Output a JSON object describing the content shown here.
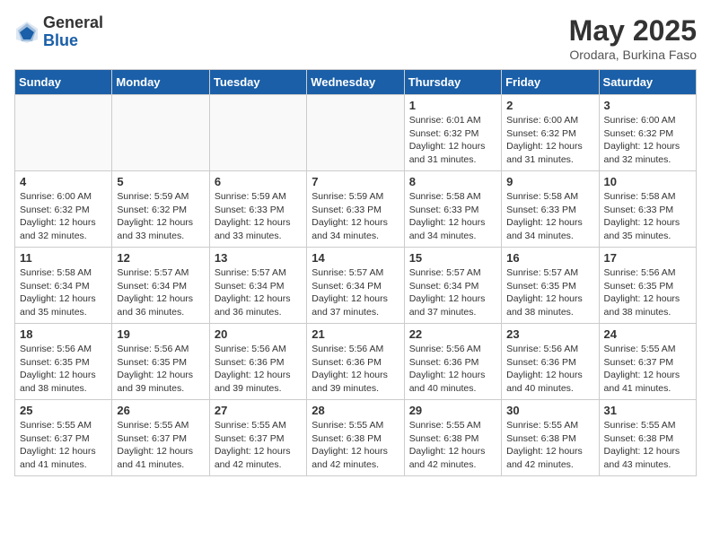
{
  "logo": {
    "general": "General",
    "blue": "Blue"
  },
  "title": "May 2025",
  "subtitle": "Orodara, Burkina Faso",
  "days": [
    "Sunday",
    "Monday",
    "Tuesday",
    "Wednesday",
    "Thursday",
    "Friday",
    "Saturday"
  ],
  "weeks": [
    [
      {
        "day": "",
        "info": ""
      },
      {
        "day": "",
        "info": ""
      },
      {
        "day": "",
        "info": ""
      },
      {
        "day": "",
        "info": ""
      },
      {
        "day": "1",
        "info": "Sunrise: 6:01 AM\nSunset: 6:32 PM\nDaylight: 12 hours\nand 31 minutes."
      },
      {
        "day": "2",
        "info": "Sunrise: 6:00 AM\nSunset: 6:32 PM\nDaylight: 12 hours\nand 31 minutes."
      },
      {
        "day": "3",
        "info": "Sunrise: 6:00 AM\nSunset: 6:32 PM\nDaylight: 12 hours\nand 32 minutes."
      }
    ],
    [
      {
        "day": "4",
        "info": "Sunrise: 6:00 AM\nSunset: 6:32 PM\nDaylight: 12 hours\nand 32 minutes."
      },
      {
        "day": "5",
        "info": "Sunrise: 5:59 AM\nSunset: 6:32 PM\nDaylight: 12 hours\nand 33 minutes."
      },
      {
        "day": "6",
        "info": "Sunrise: 5:59 AM\nSunset: 6:33 PM\nDaylight: 12 hours\nand 33 minutes."
      },
      {
        "day": "7",
        "info": "Sunrise: 5:59 AM\nSunset: 6:33 PM\nDaylight: 12 hours\nand 34 minutes."
      },
      {
        "day": "8",
        "info": "Sunrise: 5:58 AM\nSunset: 6:33 PM\nDaylight: 12 hours\nand 34 minutes."
      },
      {
        "day": "9",
        "info": "Sunrise: 5:58 AM\nSunset: 6:33 PM\nDaylight: 12 hours\nand 34 minutes."
      },
      {
        "day": "10",
        "info": "Sunrise: 5:58 AM\nSunset: 6:33 PM\nDaylight: 12 hours\nand 35 minutes."
      }
    ],
    [
      {
        "day": "11",
        "info": "Sunrise: 5:58 AM\nSunset: 6:34 PM\nDaylight: 12 hours\nand 35 minutes."
      },
      {
        "day": "12",
        "info": "Sunrise: 5:57 AM\nSunset: 6:34 PM\nDaylight: 12 hours\nand 36 minutes."
      },
      {
        "day": "13",
        "info": "Sunrise: 5:57 AM\nSunset: 6:34 PM\nDaylight: 12 hours\nand 36 minutes."
      },
      {
        "day": "14",
        "info": "Sunrise: 5:57 AM\nSunset: 6:34 PM\nDaylight: 12 hours\nand 37 minutes."
      },
      {
        "day": "15",
        "info": "Sunrise: 5:57 AM\nSunset: 6:34 PM\nDaylight: 12 hours\nand 37 minutes."
      },
      {
        "day": "16",
        "info": "Sunrise: 5:57 AM\nSunset: 6:35 PM\nDaylight: 12 hours\nand 38 minutes."
      },
      {
        "day": "17",
        "info": "Sunrise: 5:56 AM\nSunset: 6:35 PM\nDaylight: 12 hours\nand 38 minutes."
      }
    ],
    [
      {
        "day": "18",
        "info": "Sunrise: 5:56 AM\nSunset: 6:35 PM\nDaylight: 12 hours\nand 38 minutes."
      },
      {
        "day": "19",
        "info": "Sunrise: 5:56 AM\nSunset: 6:35 PM\nDaylight: 12 hours\nand 39 minutes."
      },
      {
        "day": "20",
        "info": "Sunrise: 5:56 AM\nSunset: 6:36 PM\nDaylight: 12 hours\nand 39 minutes."
      },
      {
        "day": "21",
        "info": "Sunrise: 5:56 AM\nSunset: 6:36 PM\nDaylight: 12 hours\nand 39 minutes."
      },
      {
        "day": "22",
        "info": "Sunrise: 5:56 AM\nSunset: 6:36 PM\nDaylight: 12 hours\nand 40 minutes."
      },
      {
        "day": "23",
        "info": "Sunrise: 5:56 AM\nSunset: 6:36 PM\nDaylight: 12 hours\nand 40 minutes."
      },
      {
        "day": "24",
        "info": "Sunrise: 5:55 AM\nSunset: 6:37 PM\nDaylight: 12 hours\nand 41 minutes."
      }
    ],
    [
      {
        "day": "25",
        "info": "Sunrise: 5:55 AM\nSunset: 6:37 PM\nDaylight: 12 hours\nand 41 minutes."
      },
      {
        "day": "26",
        "info": "Sunrise: 5:55 AM\nSunset: 6:37 PM\nDaylight: 12 hours\nand 41 minutes."
      },
      {
        "day": "27",
        "info": "Sunrise: 5:55 AM\nSunset: 6:37 PM\nDaylight: 12 hours\nand 42 minutes."
      },
      {
        "day": "28",
        "info": "Sunrise: 5:55 AM\nSunset: 6:38 PM\nDaylight: 12 hours\nand 42 minutes."
      },
      {
        "day": "29",
        "info": "Sunrise: 5:55 AM\nSunset: 6:38 PM\nDaylight: 12 hours\nand 42 minutes."
      },
      {
        "day": "30",
        "info": "Sunrise: 5:55 AM\nSunset: 6:38 PM\nDaylight: 12 hours\nand 42 minutes."
      },
      {
        "day": "31",
        "info": "Sunrise: 5:55 AM\nSunset: 6:38 PM\nDaylight: 12 hours\nand 43 minutes."
      }
    ]
  ]
}
